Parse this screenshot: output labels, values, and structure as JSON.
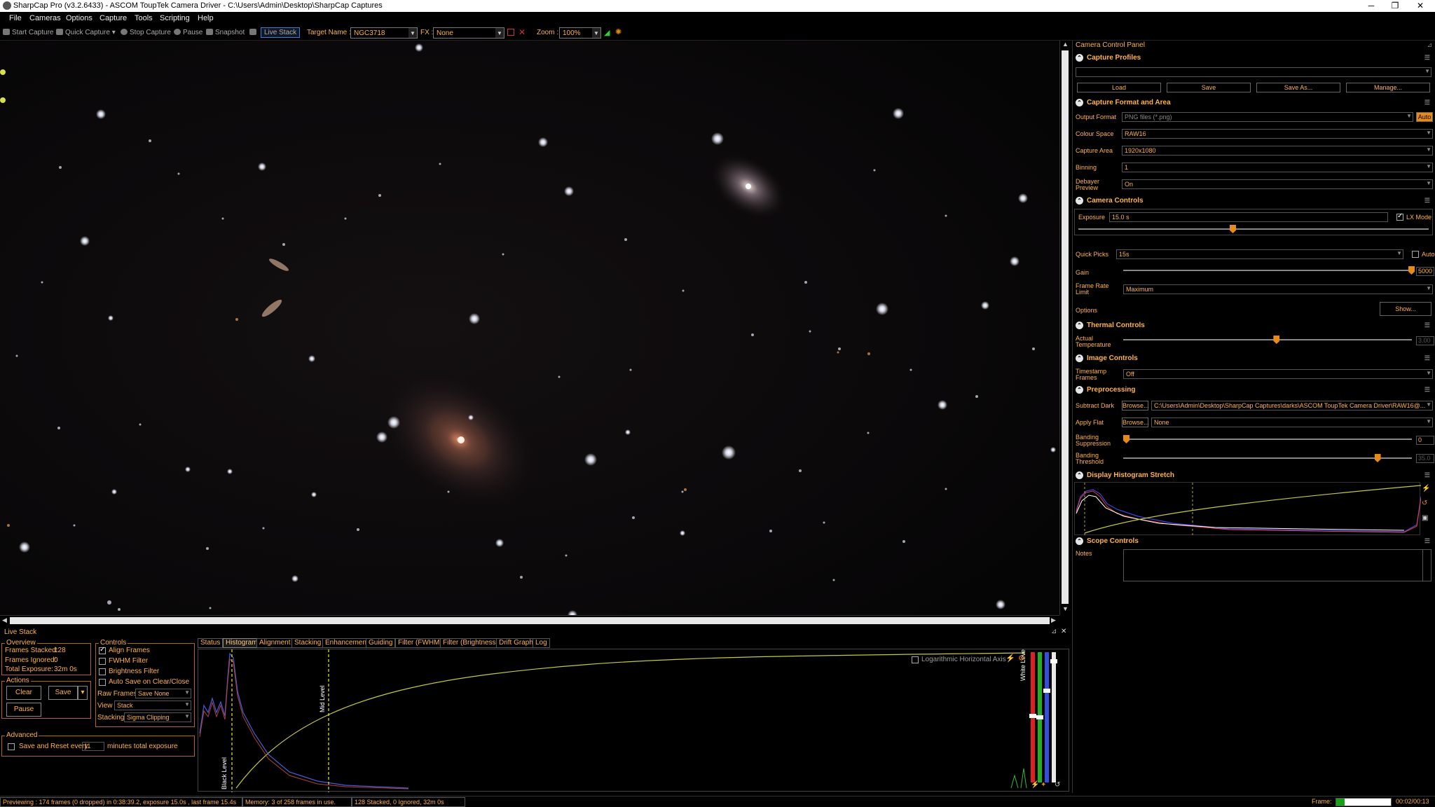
{
  "window": {
    "title": "SharpCap Pro (v3.2.6433) - ASCOM ToupTek Camera Driver - C:\\Users\\Admin\\Desktop\\SharpCap Captures",
    "minimize": "─",
    "maximize": "❐",
    "close": "✕"
  },
  "menu": [
    "File",
    "Cameras",
    "Options",
    "Capture",
    "Tools",
    "Scripting",
    "Help"
  ],
  "toolbar": {
    "start_capture": "Start Capture",
    "quick_capture": "Quick Capture",
    "stop_capture": "Stop Capture",
    "pause": "Pause",
    "snapshot": "Snapshot",
    "live_stack": "Live Stack",
    "target_name_label": "Target Name :",
    "target_name_value": "NGC3718",
    "fx_label": "FX :",
    "fx_value": "None",
    "zoom_label": "Zoom :",
    "zoom_value": "100%"
  },
  "live_stack": {
    "title": "Live Stack",
    "overview": {
      "title": "Overview",
      "frames_stacked_label": "Frames Stacked:",
      "frames_stacked_value": "128",
      "frames_ignored_label": "Frames Ignored:",
      "frames_ignored_value": "0",
      "total_exposure_label": "Total Exposure:",
      "total_exposure_value": "32m 0s"
    },
    "actions": {
      "title": "Actions",
      "clear": "Clear",
      "save": "Save",
      "pause": "Pause"
    },
    "controls": {
      "title": "Controls",
      "align_frames": "Align Frames",
      "fwhm_filter": "FWHM Filter",
      "brightness_filter": "Brightness Filter",
      "auto_save": "Auto Save on Clear/Close",
      "raw_frames_label": "Raw Frames",
      "raw_frames_value": "Save None",
      "view_label": "View",
      "view_value": "Stack",
      "stacking_label": "Stacking",
      "stacking_value": "Sigma Clipping"
    },
    "advanced": {
      "title": "Advanced",
      "save_reset": "Save and Reset every",
      "minutes_value": "11",
      "minutes_suffix": "minutes total exposure"
    },
    "tabs": [
      "Status",
      "Histogram",
      "Alignment",
      "Stacking",
      "Enhancement",
      "Guiding",
      "Filter (FWHM)",
      "Filter (Brightness)",
      "Drift Graph",
      "Log"
    ],
    "active_tab": "Histogram",
    "histogram": {
      "log_axis_label": "Logarithmic Horizontal Axis",
      "black_level": "Black Level",
      "mid_level": "Mid Level",
      "white_level": "White Level"
    }
  },
  "ccp": {
    "title": "Camera Control Panel",
    "capture_profiles": {
      "title": "Capture Profiles",
      "load": "Load",
      "save": "Save",
      "save_as": "Save As...",
      "manage": "Manage..."
    },
    "capture_format": {
      "title": "Capture Format and Area",
      "output_format_label": "Output Format",
      "output_format_value": "PNG files (*.png)",
      "auto": "Auto",
      "colour_space_label": "Colour Space",
      "colour_space_value": "RAW16",
      "capture_area_label": "Capture Area",
      "capture_area_value": "1920x1080",
      "binning_label": "Binning",
      "binning_value": "1",
      "debayer_label_1": "Debayer",
      "debayer_label_2": "Preview",
      "debayer_value": "On"
    },
    "camera_controls": {
      "title": "Camera Controls",
      "exposure_label": "Exposure",
      "exposure_value": "15.0 s",
      "lx_mode": "LX Mode",
      "exposure_slider": 0.44,
      "quick_picks_label": "Quick Picks",
      "quick_picks_value": "15s",
      "auto": "Auto",
      "gain_label": "Gain",
      "gain_value": "5000",
      "gain_slider": 1.0,
      "frame_rate_label_1": "Frame Rate",
      "frame_rate_label_2": "Limit",
      "frame_rate_value": "Maximum",
      "options_label": "Options",
      "show": "Show..."
    },
    "thermal": {
      "title": "Thermal Controls",
      "actual_temp_label_1": "Actual",
      "actual_temp_label_2": "Temperature",
      "temp_value": "3.00",
      "temp_slider": 0.53
    },
    "image_controls": {
      "title": "Image Controls",
      "timestamp_label_1": "Timestamp",
      "timestamp_label_2": "Frames",
      "timestamp_value": "Off"
    },
    "preprocessing": {
      "title": "Preprocessing",
      "subtract_dark_label": "Subtract Dark",
      "browse": "Browse...",
      "dark_path": "C:\\Users\\Admin\\Desktop\\SharpCap Captures\\darks\\ASCOM ToupTek Camera Driver\\RAW16@...",
      "apply_flat_label": "Apply Flat",
      "flat_value": "None",
      "banding_supp_label_1": "Banding",
      "banding_supp_label_2": "Suppression",
      "banding_supp_value": "0",
      "banding_supp_slider": 0.0,
      "banding_thr_label_1": "Banding",
      "banding_thr_label_2": "Threshold",
      "banding_thr_value": "35.0",
      "banding_thr_slider": 0.88
    },
    "histogram_stretch": {
      "title": "Display Histogram Stretch"
    },
    "scope_controls": {
      "title": "Scope Controls",
      "notes_label": "Notes"
    }
  },
  "status": {
    "preview": "Previewing : 174 frames (0 dropped) in 0:38:39.2, exposure 15.0s , last frame 15.4s",
    "memory": "Memory: 3 of 258 frames in use.",
    "stacked": "128 Stacked, 0 Ignored, 32m 0s",
    "frame_label": "Frame:",
    "frame_time": "00:02/00:13",
    "frame_progress": 0.15
  }
}
